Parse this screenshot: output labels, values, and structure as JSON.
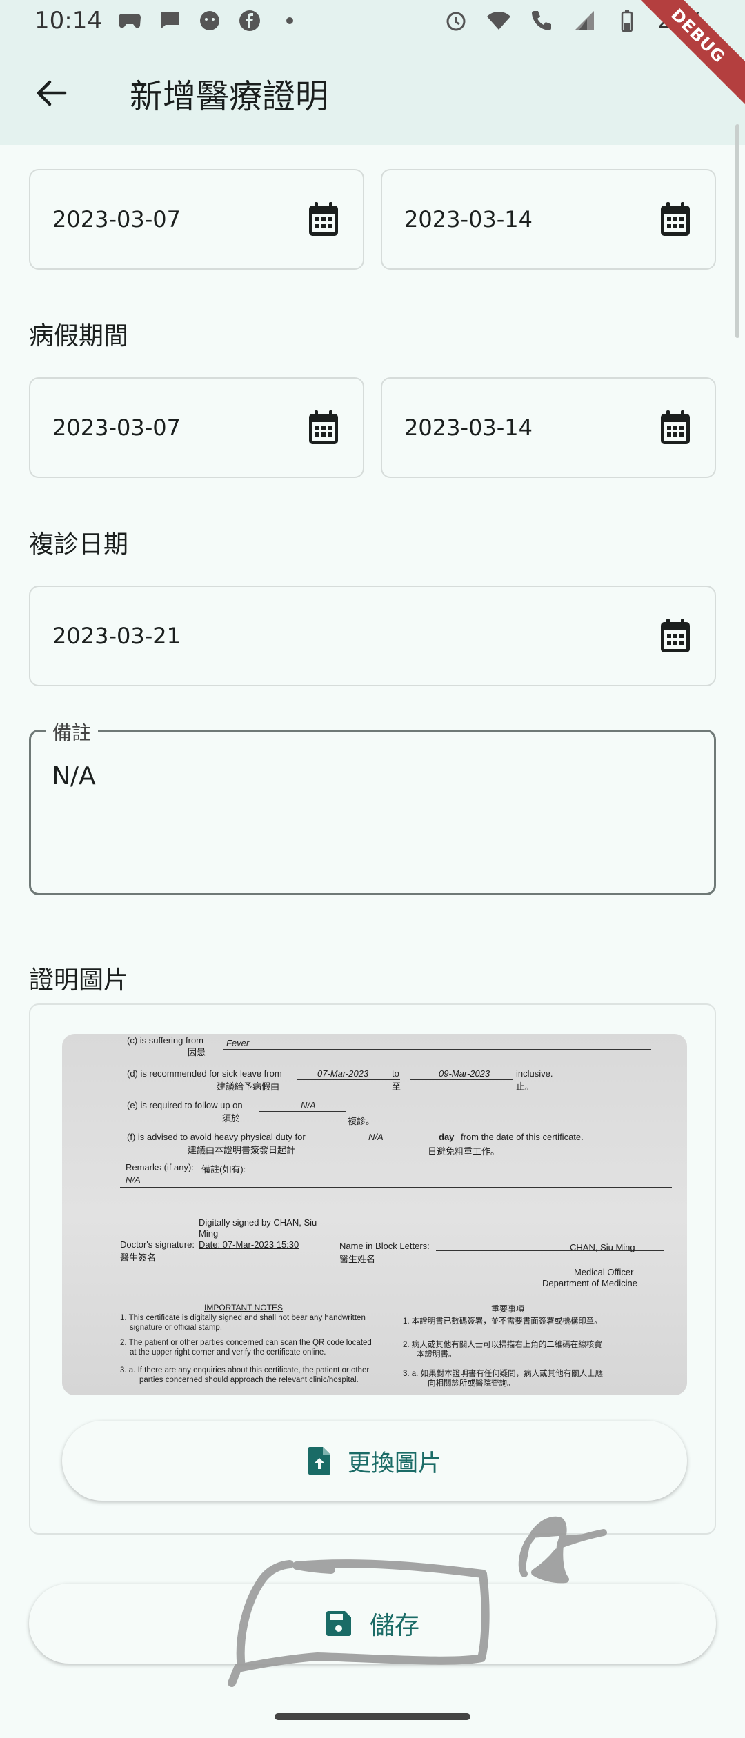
{
  "status_bar": {
    "time": "10:14",
    "battery": "28%",
    "left_icons": [
      "gamepad-icon",
      "chat-bubble-icon",
      "face-icon",
      "facebook-icon",
      "dot-icon"
    ],
    "right_icons": [
      "alarm-icon",
      "wifi-icon",
      "call-icon",
      "signal-icon",
      "battery-icon"
    ]
  },
  "debug_banner": "DEBUG",
  "app_bar": {
    "title": "新增醫療證明"
  },
  "dates": {
    "issue_from": "2023-03-07",
    "issue_to": "2023-03-14",
    "sick_leave_label": "病假期間",
    "sick_from": "2023-03-07",
    "sick_to": "2023-03-14",
    "follow_up_label": "複診日期",
    "follow_up": "2023-03-21"
  },
  "remarks": {
    "label": "備註",
    "value": "N/A"
  },
  "image_section": {
    "label": "證明圖片",
    "replace_label": "更換圖片",
    "certificate": {
      "suffering_en": "(c) is suffering from",
      "suffering_zh": "因患",
      "diagnosis": "Fever",
      "sick_leave_en": "(d) is recommended for sick leave from",
      "sick_leave_zh": "建議給予病假由",
      "leave_from": "07-Mar-2023",
      "to_en": "to",
      "to_zh": "至",
      "leave_to": "09-Mar-2023",
      "inclusive_en": "inclusive.",
      "inclusive_zh": "止。",
      "follow_en": "(e) is required to follow up on",
      "follow_zh": "須於",
      "follow_val": "N/A",
      "follow_suffix": "複診。",
      "advised_en": "(f) is advised to avoid heavy physical duty for",
      "advised_zh": "建議由本證明書簽發日起計",
      "advised_val": "N/A",
      "day_en": "day",
      "day_suffix": "from the date of this certificate.",
      "day_zh": "日避免粗重工作。",
      "remarks_en": "Remarks (if any):",
      "remarks_zh": "備註(如有):",
      "remarks_val": "N/A",
      "digital_sig_1": "Digitally signed by CHAN, Siu",
      "digital_sig_2": "Ming",
      "sig_label": "Doctor's signature:",
      "sig_date": "Date: 07-Mar-2023 15:30",
      "sig_zh": "醫生簽名",
      "name_label": "Name in Block Letters:",
      "name_zh": "醫生姓名",
      "name_val": "CHAN, Siu Ming",
      "title_1": "Medical Officer",
      "title_2": "Department of Medicine",
      "notes_en": "IMPORTANT NOTES",
      "notes_zh": "重要事項",
      "note1_en_a": "1. This certificate is digitally signed and shall not bear any handwritten",
      "note1_en_b": "signature or official stamp.",
      "note1_zh": "1.  本證明書已數碼簽署，並不需要書面簽署或機構印章。",
      "note2_en_a": "2. The patient or other parties concerned can scan the QR code located",
      "note2_en_b": "at the upper right corner and verify the certificate online.",
      "note2_zh_a": "2.  病人或其他有關人士可以掃描右上角的二維碼在線核實",
      "note2_zh_b": "本證明書。",
      "note3_en_a": "3. a.  If there are any enquiries about this certificate, the patient or other",
      "note3_en_b": "parties concerned should approach the relevant clinic/hospital.",
      "note3_zh_a": "3.  a.  如果對本證明書有任何疑問，病人或其他有關人士應",
      "note3_zh_b": "向相關診所或醫院查詢。"
    }
  },
  "save_label": "儲存"
}
